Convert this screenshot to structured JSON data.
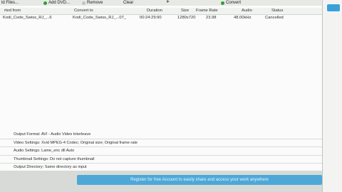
{
  "toolbar": {
    "items": [
      {
        "label": "ld Files..."
      },
      {
        "label": "Add DVD..."
      },
      {
        "label": "Remove"
      },
      {
        "label": "Clear"
      },
      {
        "label": "Convert"
      }
    ]
  },
  "table": {
    "headers": [
      "rted from",
      "Convert to",
      "Duration",
      "Size",
      "Frame Rate",
      "Audio",
      "Status"
    ],
    "rows": [
      [
        "Kodi_Code_Swiss_RJ_...6",
        "Kodi_Code_Swiss_RJ_...07_",
        "00:24:29:90",
        "1280x720",
        "23.98",
        "48.00kHz",
        "Cancelled"
      ]
    ]
  },
  "settings": {
    "output_format": "Output Format: AVI - Audio Video Interleave",
    "video_settings": "Video Settings: Xvid MPEG-4 Codec; Original size; Original frame rate",
    "audio_settings": "Audio Settings: Lame_enc dll Auto",
    "thumbnail_settings": "Thumbnail Settings: Do not capture thumbnail",
    "output_directory": "Output Directory: Same directory as input"
  },
  "banner": {
    "text": "Register for free Account to easily share and access your work anywhere"
  },
  "colors": {
    "accent_green": "#2f9d34",
    "accent_blue": "#4da8d8",
    "table_header_bg": "#f0f2ef"
  }
}
